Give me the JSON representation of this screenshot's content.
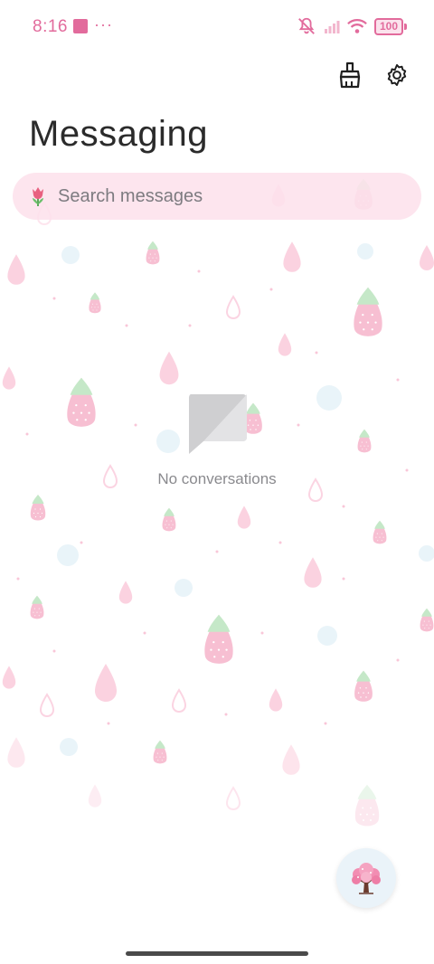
{
  "status_bar": {
    "time": "8:16",
    "more_indicator": "···",
    "battery_level": "100",
    "icons": [
      "notification-square-icon",
      "mute-icon",
      "cell-signal-icon",
      "wifi-icon",
      "battery-icon"
    ]
  },
  "toolbar": {
    "actions": [
      "clean-brush-icon",
      "settings-gear-icon"
    ]
  },
  "header": {
    "title": "Messaging"
  },
  "search": {
    "placeholder": "Search messages",
    "icon": "tulip-icon"
  },
  "empty_state": {
    "icon": "message-placeholder-icon",
    "text": "No conversations"
  },
  "fab": {
    "icon": "cherry-blossom-tree-icon"
  },
  "colors": {
    "accent_pink": "#e26b9c",
    "search_bg": "#fde1eb",
    "fab_bg": "#eaf3f9",
    "text_primary": "#2b2b2b",
    "text_secondary": "#8a8a8e"
  }
}
